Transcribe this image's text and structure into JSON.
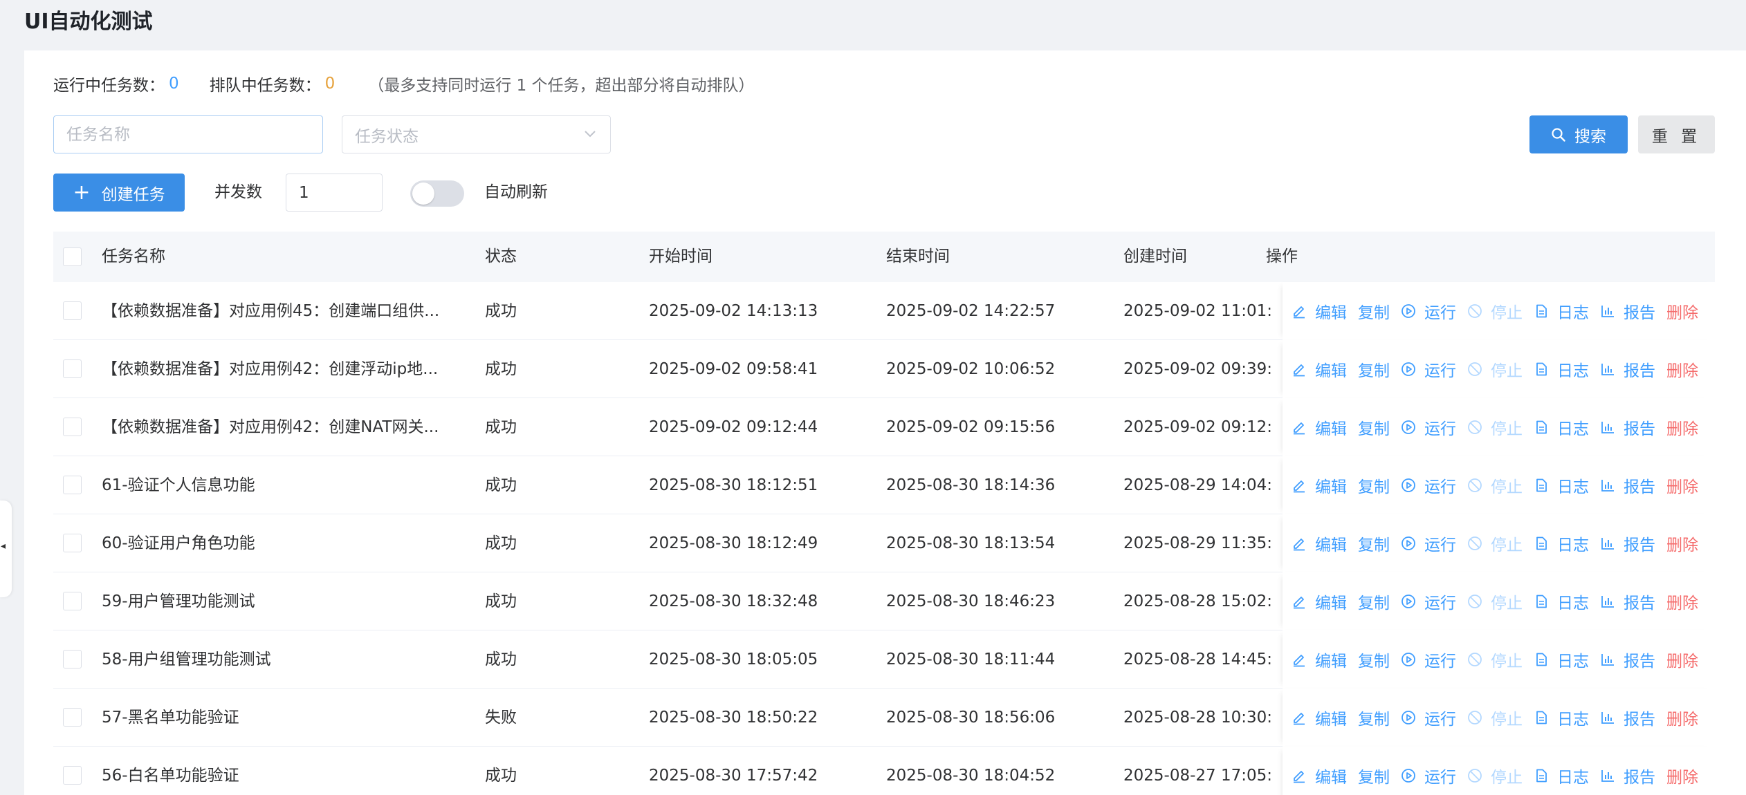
{
  "page": {
    "title": "UI自动化测试"
  },
  "status": {
    "running_label": "运行中任务数：",
    "running_count": "0",
    "queue_label": "排队中任务数：",
    "queue_count": "0",
    "hint": "（最多支持同时运行 1 个任务，超出部分将自动排队）"
  },
  "filters": {
    "task_name_placeholder": "任务名称",
    "task_status_placeholder": "任务状态",
    "search_label": "搜索",
    "reset_label": "重 置"
  },
  "toolbar": {
    "create_label": "创建任务",
    "concurrency_label": "并发数",
    "concurrency_value": "1",
    "auto_refresh_label": "自动刷新",
    "auto_refresh_on": false
  },
  "table": {
    "columns": {
      "name": "任务名称",
      "status": "状态",
      "start": "开始时间",
      "end": "结束时间",
      "created": "创建时间",
      "ops": "操作"
    },
    "actions": {
      "edit": "编辑",
      "copy": "复制",
      "run": "运行",
      "stop": "停止",
      "log": "日志",
      "report": "报告",
      "delete": "删除"
    },
    "rows": [
      {
        "name": "【依赖数据准备】对应用例45：创建端口组供...",
        "status": "成功",
        "start": "2025-09-02 14:13:13",
        "end": "2025-09-02 14:22:57",
        "created": "2025-09-02 11:01:"
      },
      {
        "name": "【依赖数据准备】对应用例42：创建浮动ip地...",
        "status": "成功",
        "start": "2025-09-02 09:58:41",
        "end": "2025-09-02 10:06:52",
        "created": "2025-09-02 09:39:"
      },
      {
        "name": "【依赖数据准备】对应用例42：创建NAT网关...",
        "status": "成功",
        "start": "2025-09-02 09:12:44",
        "end": "2025-09-02 09:15:56",
        "created": "2025-09-02 09:12:"
      },
      {
        "name": "61-验证个人信息功能",
        "status": "成功",
        "start": "2025-08-30 18:12:51",
        "end": "2025-08-30 18:14:36",
        "created": "2025-08-29 14:04:"
      },
      {
        "name": "60-验证用户角色功能",
        "status": "成功",
        "start": "2025-08-30 18:12:49",
        "end": "2025-08-30 18:13:54",
        "created": "2025-08-29 11:35:"
      },
      {
        "name": "59-用户管理功能测试",
        "status": "成功",
        "start": "2025-08-30 18:32:48",
        "end": "2025-08-30 18:46:23",
        "created": "2025-08-28 15:02:"
      },
      {
        "name": "58-用户组管理功能测试",
        "status": "成功",
        "start": "2025-08-30 18:05:05",
        "end": "2025-08-30 18:11:44",
        "created": "2025-08-28 14:45:"
      },
      {
        "name": "57-黑名单功能验证",
        "status": "失败",
        "start": "2025-08-30 18:50:22",
        "end": "2025-08-30 18:56:06",
        "created": "2025-08-28 10:30:"
      },
      {
        "name": "56-白名单功能验证",
        "status": "成功",
        "start": "2025-08-30 17:57:42",
        "end": "2025-08-30 18:04:52",
        "created": "2025-08-27 17:05:"
      }
    ]
  },
  "colors": {
    "primary": "#409eff",
    "button_primary": "#3a8ee6",
    "warning": "#e6a23c",
    "danger": "#f56c6c",
    "disabled": "#b3d8ff"
  },
  "icons": {
    "edit": "edit-icon",
    "run": "play-circle-icon",
    "stop": "ban-icon",
    "log": "document-icon",
    "report": "bar-chart-icon",
    "search": "search-icon",
    "create": "plus-icon",
    "select": "chevron-down-icon",
    "edge": "caret-left-icon"
  }
}
